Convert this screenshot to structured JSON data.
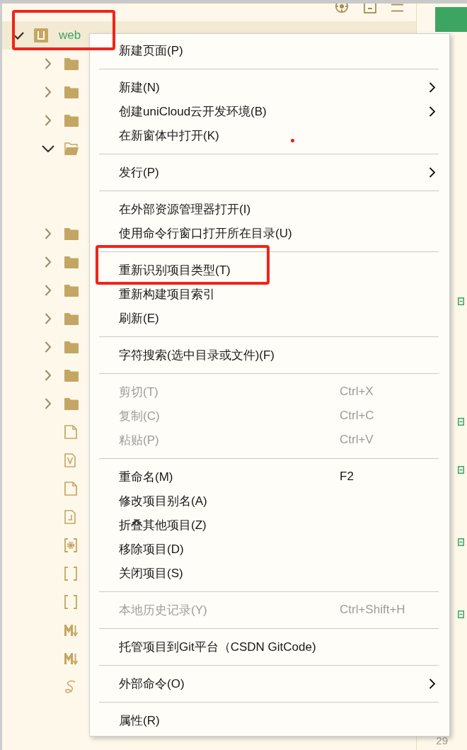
{
  "sidebar": {
    "project": {
      "name": "web",
      "expanded": true,
      "selected": true,
      "marked": true
    },
    "tree": [
      {
        "kind": "folder",
        "expanded": false,
        "selected": false
      },
      {
        "kind": "folder",
        "expanded": false,
        "selected": false
      },
      {
        "kind": "folder",
        "expanded": false,
        "selected": false
      },
      {
        "kind": "folder",
        "expanded": true,
        "selected": false
      },
      {
        "kind": "folder",
        "expanded": false,
        "selected": false
      },
      {
        "kind": "folder",
        "expanded": false,
        "selected": false
      },
      {
        "kind": "folder",
        "expanded": false,
        "selected": false
      },
      {
        "kind": "folder",
        "expanded": false,
        "selected": false
      },
      {
        "kind": "folder",
        "expanded": false,
        "selected": false
      },
      {
        "kind": "folder",
        "expanded": false,
        "selected": false
      },
      {
        "kind": "folder",
        "expanded": false,
        "selected": false
      },
      {
        "kind": "file",
        "selected": false
      },
      {
        "kind": "vue",
        "selected": false
      },
      {
        "kind": "file",
        "selected": false
      },
      {
        "kind": "js",
        "selected": false
      },
      {
        "kind": "config",
        "selected": false
      },
      {
        "kind": "json",
        "selected": false
      },
      {
        "kind": "json",
        "selected": false
      },
      {
        "kind": "markdown",
        "selected": false
      },
      {
        "kind": "markdown",
        "selected": false
      },
      {
        "kind": "sass",
        "selected": false
      }
    ]
  },
  "editor": {
    "lines": [
      {
        "fold": false
      },
      {
        "fold": false
      },
      {
        "fold": false
      },
      {
        "fold": false
      },
      {
        "fold": false
      },
      {
        "fold": false
      },
      {
        "fold": false
      },
      {
        "fold": false
      },
      {
        "fold": false
      },
      {
        "fold": false
      },
      {
        "fold": true
      },
      {
        "fold": false
      },
      {
        "fold": false
      },
      {
        "fold": false
      },
      {
        "fold": false
      },
      {
        "fold": true
      },
      {
        "fold": false
      },
      {
        "fold": true
      },
      {
        "fold": false
      },
      {
        "fold": false
      },
      {
        "fold": true
      },
      {
        "fold": false
      },
      {
        "fold": false
      },
      {
        "fold": true
      },
      {
        "fold": false
      },
      {
        "fold": false
      },
      {
        "fold": false
      },
      {
        "fold": false
      },
      {
        "number": "29",
        "fold": false
      }
    ]
  },
  "context_menu": {
    "groups": [
      [
        {
          "label": "新建页面(P)",
          "disabled": false,
          "submenu": false,
          "marked": false
        }
      ],
      [
        {
          "label": "新建(N)",
          "disabled": false,
          "submenu": true,
          "marked": false
        },
        {
          "label": "创建uniCloud云开发环境(B)",
          "disabled": false,
          "submenu": true,
          "marked": false
        },
        {
          "label": "在新窗体中打开(K)",
          "disabled": false,
          "submenu": false,
          "marked": false
        }
      ],
      [
        {
          "label": "发行(P)",
          "disabled": false,
          "submenu": true,
          "marked": false
        }
      ],
      [
        {
          "label": "在外部资源管理器打开(I)",
          "disabled": false,
          "submenu": false,
          "marked": false
        },
        {
          "label": "使用命令行窗口打开所在目录(U)",
          "disabled": false,
          "submenu": false,
          "marked": false
        }
      ],
      [
        {
          "label": "重新识别项目类型(T)",
          "disabled": false,
          "submenu": false,
          "marked": true
        },
        {
          "label": "重新构建项目索引",
          "disabled": false,
          "submenu": false,
          "marked": false
        },
        {
          "label": "刷新(E)",
          "disabled": false,
          "submenu": false,
          "marked": false
        }
      ],
      [
        {
          "label": "字符搜索(选中目录或文件)(F)",
          "disabled": false,
          "submenu": false,
          "marked": false
        }
      ],
      [
        {
          "label": "剪切(T)",
          "shortcut": "Ctrl+X",
          "disabled": true,
          "submenu": false,
          "marked": false
        },
        {
          "label": "复制(C)",
          "shortcut": "Ctrl+C",
          "disabled": true,
          "submenu": false,
          "marked": false
        },
        {
          "label": "粘贴(P)",
          "shortcut": "Ctrl+V",
          "disabled": true,
          "submenu": false,
          "marked": false
        }
      ],
      [
        {
          "label": "重命名(M)",
          "shortcut": "F2",
          "disabled": false,
          "submenu": false,
          "marked": false
        },
        {
          "label": "修改项目别名(A)",
          "disabled": false,
          "submenu": false,
          "marked": false
        },
        {
          "label": "折叠其他项目(Z)",
          "disabled": false,
          "submenu": false,
          "marked": false
        },
        {
          "label": "移除项目(D)",
          "disabled": false,
          "submenu": false,
          "marked": false
        },
        {
          "label": "关闭项目(S)",
          "disabled": false,
          "submenu": false,
          "marked": false
        }
      ],
      [
        {
          "label": "本地历史记录(Y)",
          "shortcut": "Ctrl+Shift+H",
          "disabled": true,
          "submenu": false,
          "marked": false
        }
      ],
      [
        {
          "label": "托管项目到Git平台（CSDN GitCode)",
          "disabled": false,
          "submenu": false,
          "marked": false
        }
      ],
      [
        {
          "label": "外部命令(O)",
          "disabled": false,
          "submenu": true,
          "marked": false
        }
      ],
      [
        {
          "label": "属性(R)",
          "disabled": false,
          "submenu": false,
          "marked": false
        }
      ]
    ]
  }
}
